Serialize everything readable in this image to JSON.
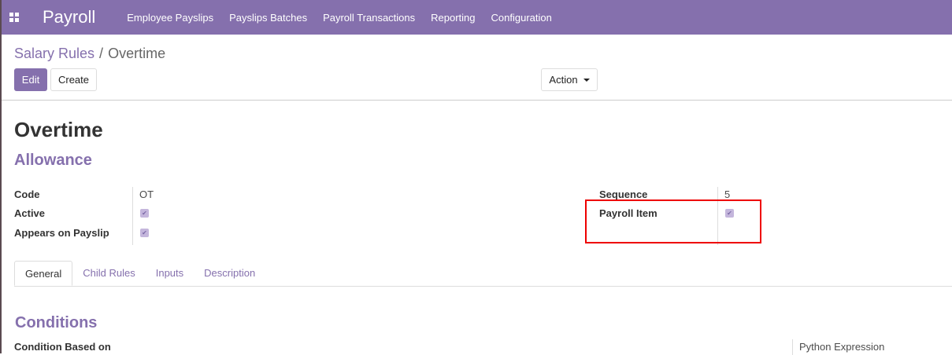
{
  "nav": {
    "brand": "Payroll",
    "menu": [
      "Employee Payslips",
      "Payslips Batches",
      "Payroll Transactions",
      "Reporting",
      "Configuration"
    ]
  },
  "breadcrumb": {
    "parent": "Salary Rules",
    "sep": "/",
    "current": "Overtime"
  },
  "buttons": {
    "edit": "Edit",
    "create": "Create",
    "action": "Action"
  },
  "form": {
    "title": "Overtime",
    "category": "Allowance",
    "left": [
      {
        "label": "Code",
        "value": "OT"
      },
      {
        "label": "Active",
        "checked": true
      },
      {
        "label": "Appears on Payslip",
        "checked": true
      }
    ],
    "right": [
      {
        "label": "Sequence",
        "value": "5"
      },
      {
        "label": "Payroll Item",
        "checked": true
      }
    ],
    "tabs": [
      "General",
      "Child Rules",
      "Inputs",
      "Description"
    ],
    "conditions": {
      "heading": "Conditions",
      "label": "Condition Based on",
      "value": "Python Expression"
    }
  },
  "colors": {
    "brand": "#8570ad",
    "highlight": "#e00000"
  }
}
